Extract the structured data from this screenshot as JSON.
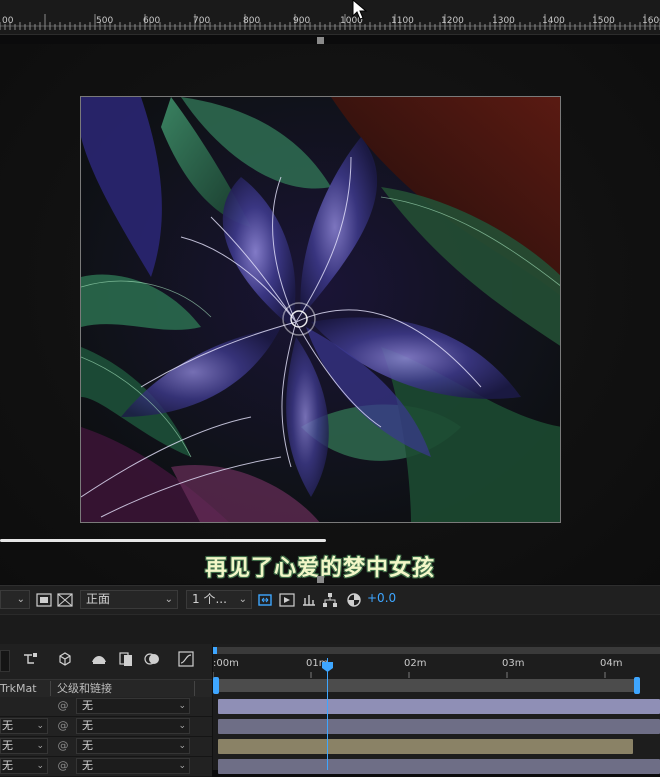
{
  "ruler": {
    "ticks": [
      "600",
      "700",
      "800",
      "900",
      "1000",
      "1100",
      "1200",
      "1300",
      "1400",
      "1500",
      "1600"
    ],
    "partial_left": "500",
    "first_visible": "00"
  },
  "viewer": {
    "subtitle": "再见了心爱的梦中女孩"
  },
  "toolbar": {
    "view_label": "正面",
    "views_label": "1 个...",
    "offset_value": "+0.0",
    "left_dropdown": ""
  },
  "timeline": {
    "column_trkmat": "TrkMat",
    "column_parent": "父级和链接",
    "time_markers": [
      ":00m",
      "01m",
      "02m",
      "03m",
      "04m"
    ],
    "rows": [
      {
        "mode": "",
        "parent": "无"
      },
      {
        "mode": "无",
        "parent": "无"
      },
      {
        "mode": "无",
        "parent": "无"
      },
      {
        "mode": "无",
        "parent": "无"
      }
    ]
  },
  "colors": {
    "accent": "#3ea6ff",
    "track_purple": "#8f8fb6",
    "track_tan": "#8a8266"
  }
}
